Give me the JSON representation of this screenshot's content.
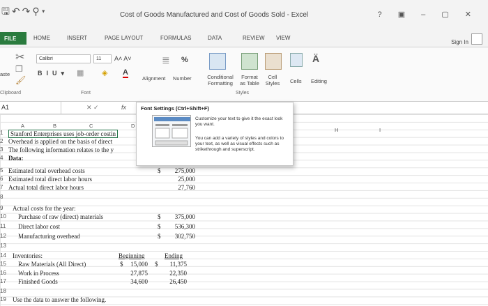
{
  "window": {
    "title": "Cost of Goods Manufactured and Cost of Goods Sold - Excel",
    "controls": "? ▣ – ▢ ✕"
  },
  "tabs": [
    "FILE",
    "HOME",
    "INSERT",
    "PAGE LAYOUT",
    "FORMULAS",
    "DATA",
    "REVIEW",
    "VIEW"
  ],
  "signin": "Sign In",
  "ribbon": {
    "paste": "aste",
    "clipboard": "Clipboard",
    "font_name": "Calibri",
    "font_size": "11",
    "font_group": "Font",
    "alignment": "Alignment",
    "number": "Number",
    "percent": "%",
    "conditional_formatting": "Conditional Formatting",
    "format_as_table": "Format as Table",
    "cell_styles": "Cell Styles",
    "styles_group": "Styles",
    "cells": "Cells",
    "editing": "Editing"
  },
  "formula_bar": {
    "name_box": "A1",
    "fx": "fx"
  },
  "tooltip": {
    "title": "Font Settings (Ctrl+Shift+F)",
    "p1": "Customize your text to give it the exact look you want.",
    "p2": "You can add a variety of styles and colors to your text, as well as visual effects such as strikethrough and superscript."
  },
  "columns": [
    "A",
    "B",
    "C",
    "D",
    "H",
    "I"
  ],
  "rows": {
    "r1": "Stanford Enterprises uses job-order costin",
    "r2": "Overhead is applied on the basis of direct",
    "r3": "The following information relates to the y",
    "r4": "Data:",
    "r5": "Estimated total overhead costs",
    "r6": "Estimated total direct labor hours",
    "r7": "Actual total direct labor hours",
    "r9": "Actual costs for the year:",
    "r10": "Purchase of raw (direct) materials",
    "r11": "Direct labor cost",
    "r12": "Manufacturing overhead",
    "r14": "Inventories:",
    "r15": "Raw Materials (All Direct)",
    "r16": "Work in Process",
    "r17": "Finished Goods",
    "r19": "Use the data to answer the following."
  },
  "values": {
    "dollar": "$",
    "v5": "275,000",
    "v6": "25,000",
    "v7": "27,760",
    "v10": "375,000",
    "v11": "536,300",
    "v12": "302,750",
    "beginning": "Beginning",
    "ending": "Ending",
    "b15": "15,000",
    "b16": "27,875",
    "b17": "34,600",
    "e15": "11,375",
    "e16": "22,350",
    "e17": "26,450"
  },
  "row_numbers": [
    "1",
    "2",
    "3",
    "4",
    "5",
    "6",
    "7",
    "8",
    "9",
    "10",
    "11",
    "12",
    "13",
    "14",
    "15",
    "16",
    "17",
    "18",
    "19"
  ]
}
